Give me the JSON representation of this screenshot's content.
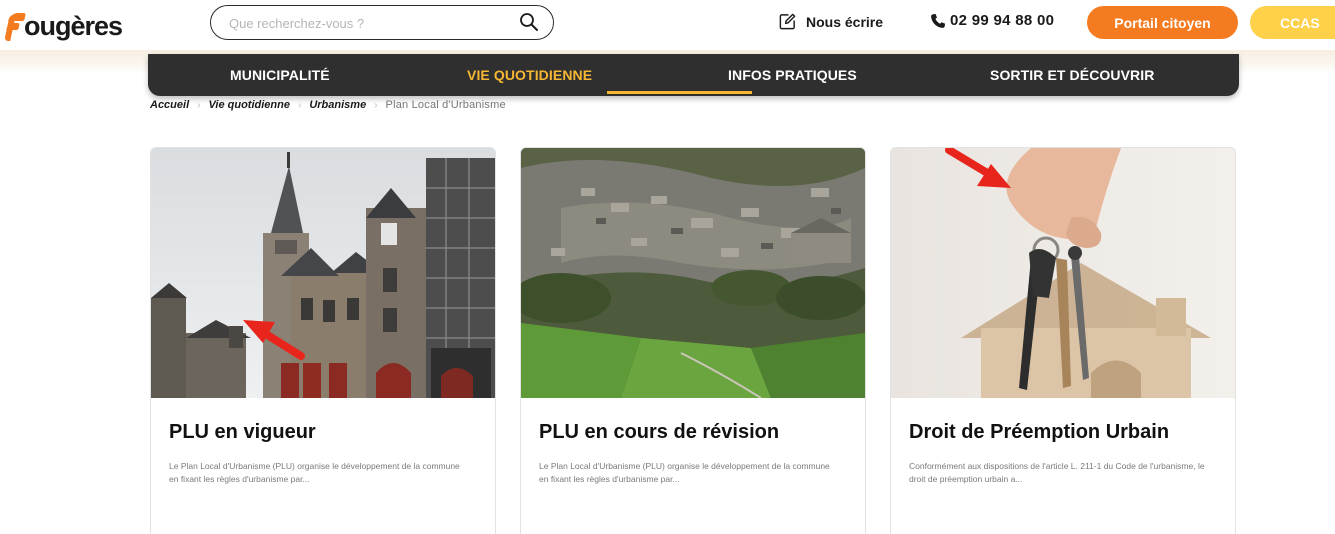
{
  "header": {
    "logo_text": "ougères",
    "search": {
      "placeholder": "Que recherchez-vous ?"
    },
    "contact_label": "Nous écrire",
    "phone": "02 99 94 88 00",
    "portail_label": "Portail citoyen",
    "ccas_label": "CCAS"
  },
  "nav": {
    "items": [
      {
        "label": "MUNICIPALITÉ",
        "active": false
      },
      {
        "label": "VIE QUOTIDIENNE",
        "active": true
      },
      {
        "label": "INFOS PRATIQUES",
        "active": false
      },
      {
        "label": "SORTIR ET DÉCOUVRIR",
        "active": false
      }
    ]
  },
  "breadcrumb": {
    "items": [
      "Accueil",
      "Vie quotidienne",
      "Urbanisme"
    ],
    "current": "Plan Local d'Urbanisme",
    "separator": "›"
  },
  "cards": [
    {
      "title": "PLU en vigueur",
      "text": "Le Plan Local d'Urbanisme (PLU) organise le développement de la commune en fixant les règles d'urbanisme par..."
    },
    {
      "title": "PLU en cours de révision",
      "text": "Le Plan Local d'Urbanisme (PLU) organise le développement de la commune en fixant les règles d'urbanisme par..."
    },
    {
      "title": "Droit de Préemption Urbain",
      "text": "Conformément aux dispositions de l'article L. 211-1 du Code de l'urbanisme, le droit de préemption urbain a..."
    }
  ],
  "colors": {
    "brand_orange": "#f47b20",
    "ccas_yellow": "#ffd04a",
    "nav_bg": "#2f2f2f",
    "nav_active": "#f7b733",
    "annotation_arrow": "#e8251c"
  },
  "icons": {
    "search": "search-icon",
    "write": "edit-icon",
    "phone": "phone-icon",
    "arrow": "red-arrow-icon"
  }
}
